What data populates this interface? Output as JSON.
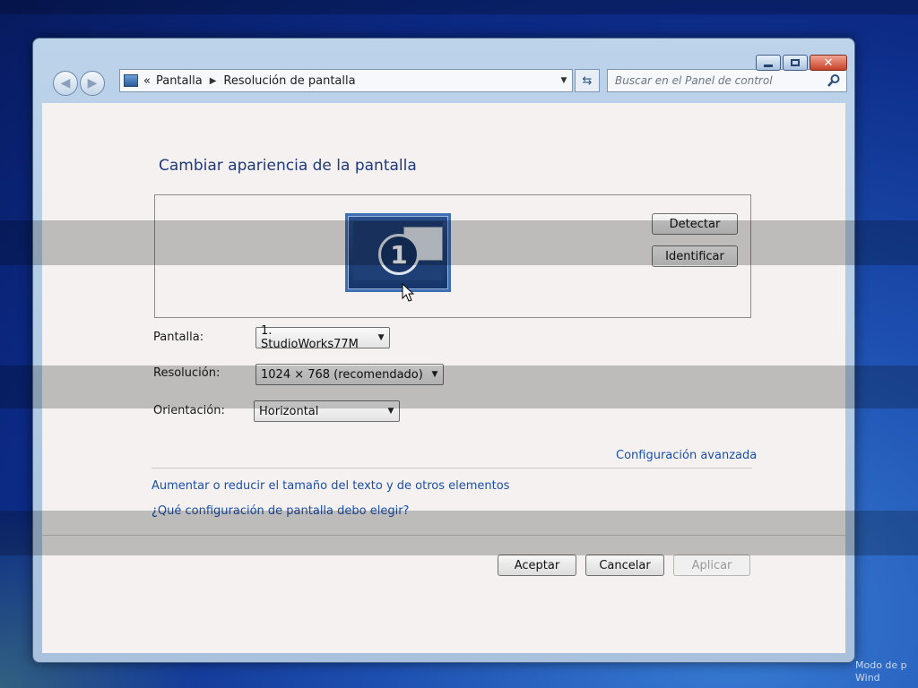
{
  "window": {
    "breadcrumb": {
      "overflow": "«",
      "items": [
        "Pantalla",
        "Resolución de pantalla"
      ]
    },
    "search": {
      "placeholder": "Buscar en el Panel de control"
    },
    "controls": {
      "close_glyph": "✕"
    }
  },
  "page": {
    "title": "Cambiar apariencia de la pantalla",
    "monitor_number": "1",
    "detect_label": "Detectar",
    "identify_label": "Identificar"
  },
  "form": {
    "display": {
      "label": "Pantalla:",
      "value": "1. StudioWorks77M"
    },
    "resolution": {
      "label": "Resolución:",
      "value": "1024 × 768 (recomendado)"
    },
    "orientation": {
      "label": "Orientación:",
      "value": "Horizontal"
    }
  },
  "links": {
    "advanced": "Configuración avanzada",
    "text_size": "Aumentar o reducir el tamaño del texto y de otros elementos",
    "which_settings": "¿Qué configuración de pantalla debo elegir?"
  },
  "buttons": {
    "ok": "Aceptar",
    "cancel": "Cancelar",
    "apply": "Aplicar"
  },
  "desktop": {
    "corner_text": "Modo de p Wind"
  },
  "colors": {
    "link": "#1c4fa8",
    "title": "#1f3a7a",
    "desktop_bg": "#0c2a86"
  },
  "icons": {
    "back": "back-arrow-icon",
    "forward": "forward-arrow-icon",
    "address": "control-panel-icon",
    "refresh": "refresh-icon",
    "search": "search-icon"
  }
}
